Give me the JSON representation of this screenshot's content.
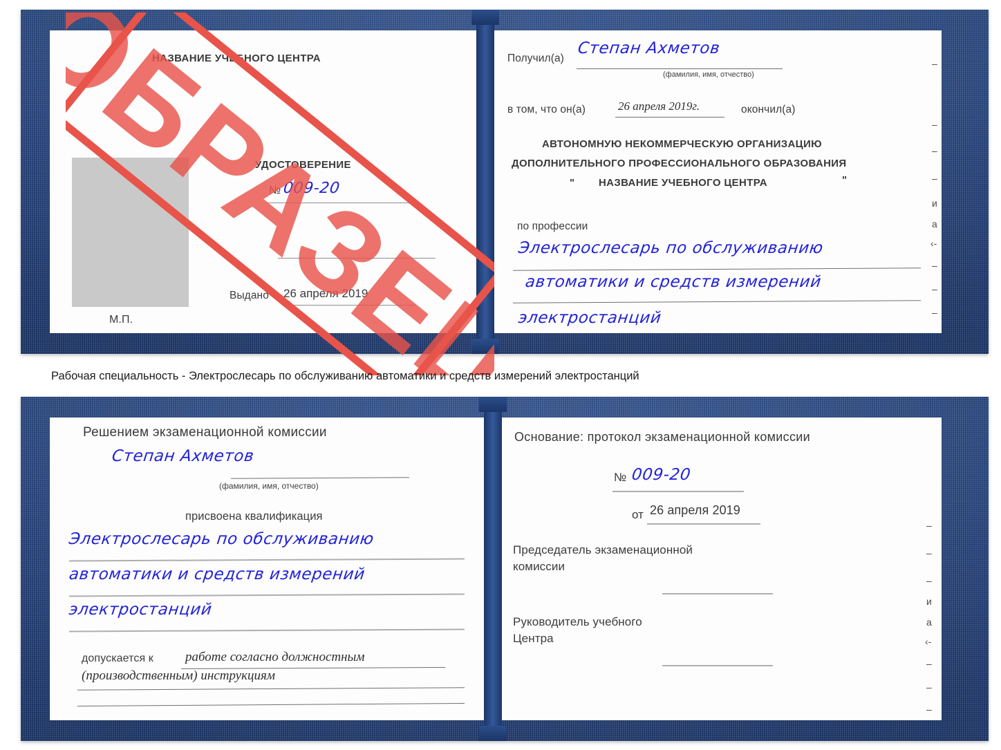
{
  "watermark": {
    "text": "ОБРАЗЕЦ",
    "color": "#e8534a"
  },
  "caption": {
    "text": "Рабочая специальность - Электрослесарь по обслуживанию автоматики и средств измерений электростанций"
  },
  "colors": {
    "cover_blue": "#234382",
    "handwriting_blue": "#2323d8",
    "stamp_red": "#e8534a",
    "photo_placeholder_gray": "#c9c9c9",
    "page_white": "#fdfdfd",
    "rule_gray": "#8e8e8e"
  },
  "certificate_top": {
    "left_page": {
      "org_title": "НАЗВАНИЕ УЧЕБНОГО ЦЕНТРА",
      "doc_title": "УДОСТОВЕРЕНИЕ",
      "number_label": "№",
      "number_value": "009-20",
      "issued_label": "Выдано",
      "issued_value": "26 апреля 2019",
      "seal_label": "М.П.",
      "photo_placeholder": "photo-placeholder"
    },
    "right_page": {
      "received_label": "Получил(а)",
      "received_value": "Степан Ахметов",
      "name_hint": "(фамилия, имя, отчество)",
      "in_that_label": "в том, что он(а)",
      "in_that_value": "26 апреля 2019г.",
      "finished_label": "окончил(а)",
      "org_line1": "АВТОНОМНУЮ НЕКОММЕРЧЕСКУЮ ОРГАНИЗАЦИЮ",
      "org_line2": "ДОПОЛНИТЕЛЬНОГО ПРОФЕССИОНАЛЬНОГО ОБРАЗОВАНИЯ",
      "org_quote_open": "\"",
      "org_line3": "НАЗВАНИЕ УЧЕБНОГО ЦЕНТРА",
      "org_quote_close": "\"",
      "profession_label": "по профессии",
      "profession_line1": "Электрослесарь по обслуживанию",
      "profession_line2": "автоматики и средств измерений",
      "profession_line3": "электростанций",
      "edge_marks": [
        "–",
        "–",
        "–",
        "и",
        "а",
        "‹-",
        "–"
      ]
    }
  },
  "certificate_bottom": {
    "left_page": {
      "heading": "Решением экзаменационной комиссии",
      "name_value": "Степан Ахметов",
      "name_hint": "(фамилия, имя, отчество)",
      "qualification_label": "присвоена квалификация",
      "qualification_line1": "Электрослесарь по обслуживанию",
      "qualification_line2": "автоматики и средств измерений",
      "qualification_line3": "электростанций",
      "admitted_label": "допускается к",
      "admitted_line1": "работе согласно должностным",
      "admitted_line2": "(производственным) инструкциям"
    },
    "right_page": {
      "basis_label": "Основание: протокол экзаменационной комиссии",
      "number_label": "№",
      "number_value": "009-20",
      "date_label": "от",
      "date_value": "26 апреля 2019",
      "chairman_line1": "Председатель экзаменационной",
      "chairman_line2": "комиссии",
      "head_line1": "Руководитель учебного",
      "head_line2": "Центра",
      "edge_marks": [
        "–",
        "–",
        "–",
        "и",
        "а",
        "‹-",
        "–",
        "–",
        "–"
      ]
    }
  }
}
